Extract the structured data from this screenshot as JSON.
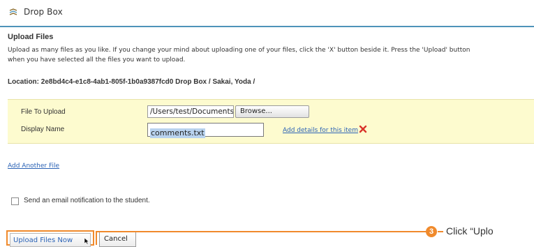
{
  "header": {
    "title": "Drop Box",
    "icon": "dropbox-icon"
  },
  "section": {
    "title": "Upload Files",
    "instructions_line1": "Upload as many files as you like. If you change your mind about uploading one of your files, click the 'X' button beside it. Press the 'Upload' button",
    "instructions_line2": "when you have selected all the files you want to upload."
  },
  "location": {
    "text": "Location: 2e8bd4c4-e1c8-4ab1-805f-1b0a9387fcd0 Drop Box / Sakai, Yoda /"
  },
  "file_row": {
    "file_label": "File To Upload",
    "file_value": "/Users/test/Documents/c",
    "browse_label": "Browse...",
    "display_label": "Display Name",
    "display_value": "comments.txt",
    "details_link": "Add details for this item",
    "remove_icon": "remove-x-icon"
  },
  "add_another_link": "Add Another File",
  "notify": {
    "label": "Send an email notification to the student.",
    "checked": false
  },
  "buttons": {
    "upload": "Upload Files Now",
    "cancel": "Cancel"
  },
  "callout": {
    "number": "3",
    "text": "Click “Uplo"
  },
  "colors": {
    "accent": "#f08a2c",
    "link": "#2a62b5",
    "panel": "#fdfbcf",
    "header_rule": "#4e93b9"
  }
}
